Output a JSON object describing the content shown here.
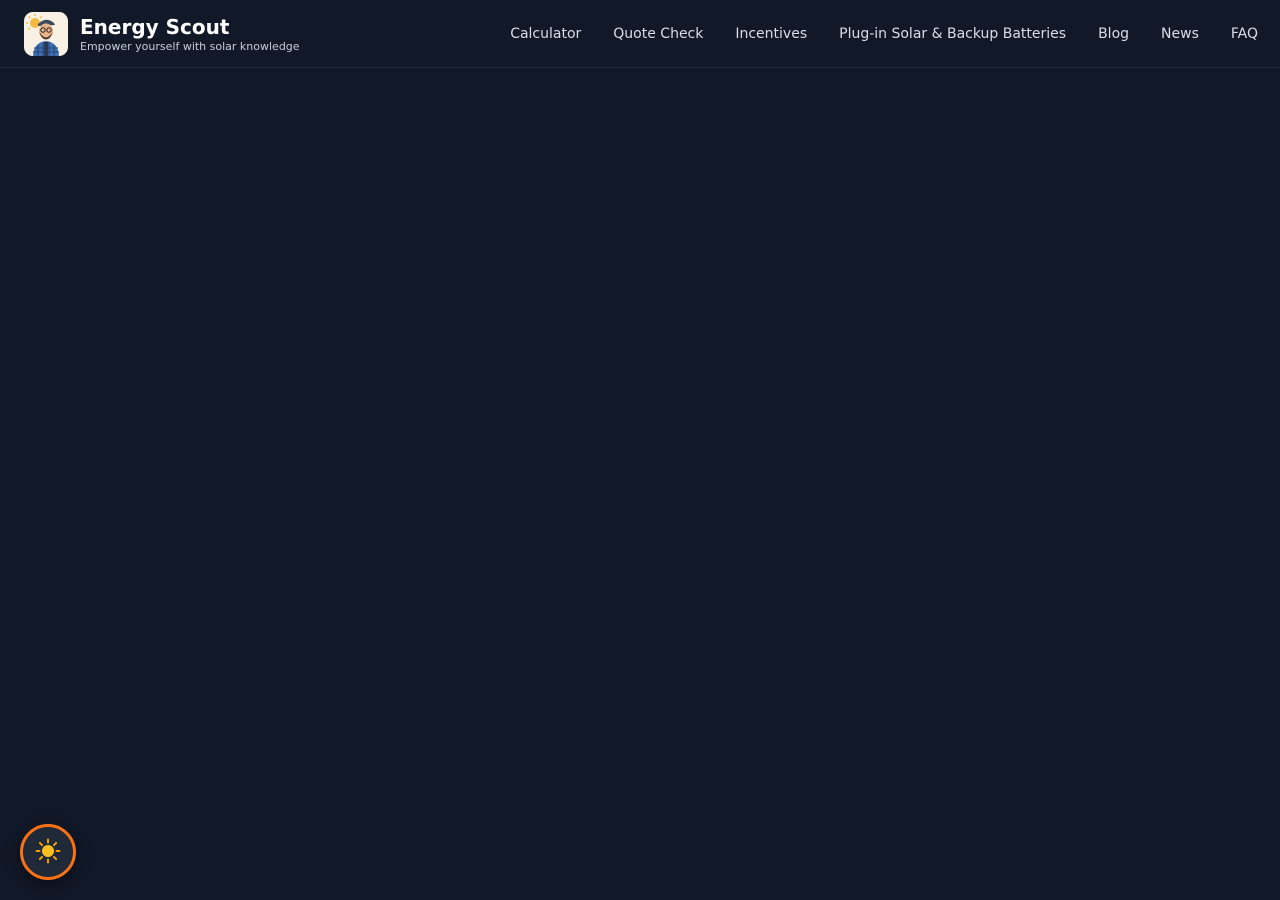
{
  "brand": {
    "title": "Energy Scout",
    "tagline": "Empower yourself with solar knowledge",
    "logo_icon": "solar-mascot-icon"
  },
  "nav": {
    "items": [
      {
        "label": "Calculator"
      },
      {
        "label": "Quote Check"
      },
      {
        "label": "Incentives"
      },
      {
        "label": "Plug-in Solar & Backup Batteries"
      },
      {
        "label": "Blog"
      },
      {
        "label": "News"
      },
      {
        "label": "FAQ"
      }
    ]
  },
  "theme_toggle": {
    "icon": "sun-icon",
    "accent_color": "#f97316"
  },
  "colors": {
    "background": "#111827",
    "text": "#ffffff"
  }
}
